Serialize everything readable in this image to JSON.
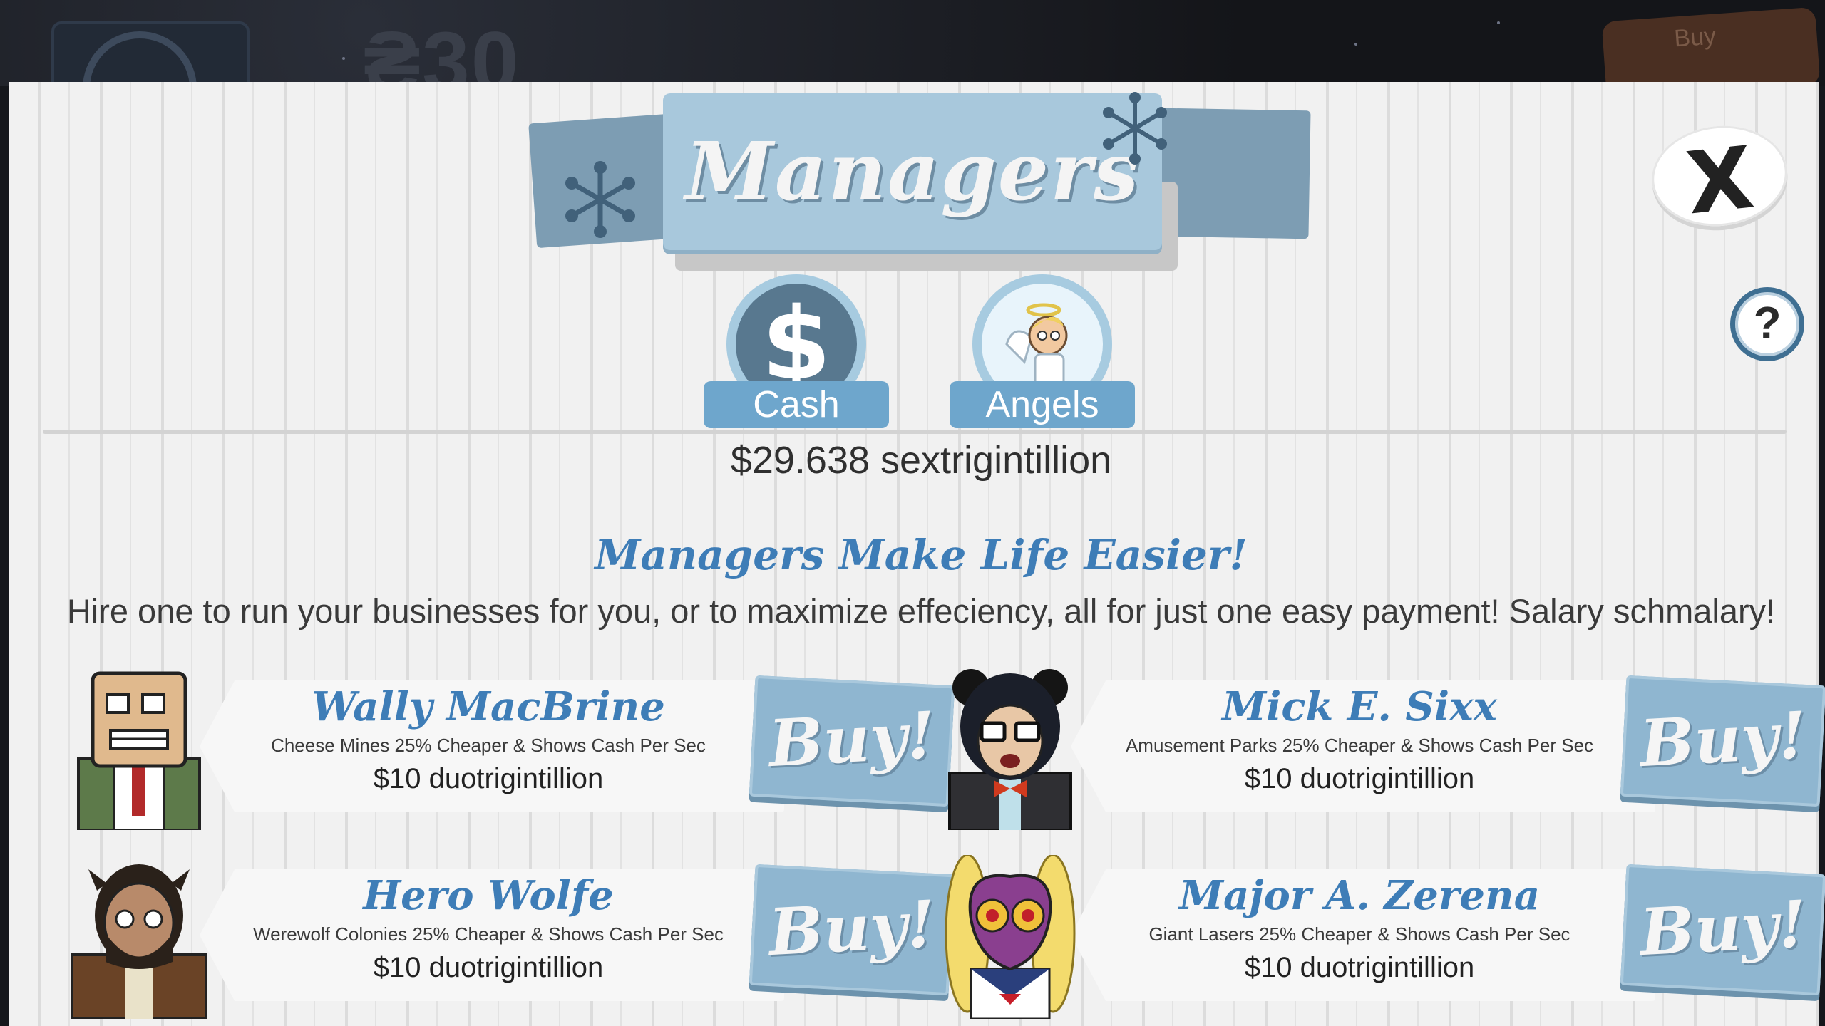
{
  "background": {
    "money_partial": "₴30",
    "buy_label": "Buy"
  },
  "header": {
    "title": "Managers",
    "close_label": "X",
    "help_label": "?"
  },
  "tabs": [
    {
      "label": "Cash",
      "icon": "dollar-icon"
    },
    {
      "label": "Angels",
      "icon": "angel-icon"
    }
  ],
  "balance": "$29.638 sextrigintillion",
  "headline": "Managers Make Life Easier!",
  "tagline": "Hire one to run your businesses for you, or to maximize effeciency, all for just one easy payment! Salary schmalary!",
  "managers": [
    {
      "name": "Wally MacBrine",
      "description": "Cheese Mines 25% Cheaper & Shows Cash Per Sec",
      "price": "$10 duotrigintillion",
      "buy_label": "Buy!"
    },
    {
      "name": "Mick E. Sixx",
      "description": "Amusement Parks 25% Cheaper & Shows Cash Per Sec",
      "price": "$10 duotrigintillion",
      "buy_label": "Buy!"
    },
    {
      "name": "Hero Wolfe",
      "description": "Werewolf Colonies 25% Cheaper & Shows Cash Per Sec",
      "price": "$10 duotrigintillion",
      "buy_label": "Buy!"
    },
    {
      "name": "Major A. Zerena",
      "description": "Giant Lasers 25% Cheaper & Shows Cash Per Sec",
      "price": "$10 duotrigintillion",
      "buy_label": "Buy!"
    }
  ],
  "colors": {
    "accent_blue": "#3e7db7",
    "button_blue": "#8fb6d0",
    "banner_blue": "#a8c8dc",
    "tab_label_blue": "#6ea6cc",
    "panel_bg": "#f1f1f1"
  }
}
